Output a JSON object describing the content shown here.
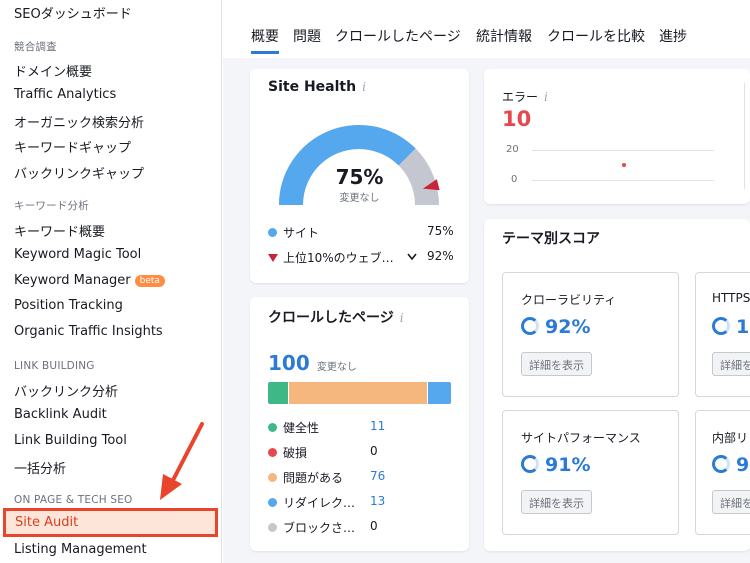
{
  "sidebar": {
    "top_item": "SEOダッシュボード",
    "sections": {
      "competitive": "競合調査",
      "keyword": "キーワード分析",
      "link": "LINK BUILDING",
      "onpage": "ON PAGE & TECH SEO"
    },
    "items": {
      "domain_overview": "ドメイン概要",
      "traffic_analytics": "Traffic Analytics",
      "organic": "オーガニック検索分析",
      "keyword_gap": "キーワードギャップ",
      "backlink_gap": "バックリンクギャップ",
      "keyword_overview": "キーワード概要",
      "keyword_magic": "Keyword Magic Tool",
      "keyword_manager": "Keyword Manager",
      "keyword_manager_badge": "beta",
      "position_tracking": "Position Tracking",
      "organic_insights": "Organic Traffic Insights",
      "backlink_analysis": "バックリンク分析",
      "backlink_audit": "Backlink Audit",
      "link_building": "Link Building Tool",
      "bulk_analysis": "一括分析",
      "site_audit": "Site Audit",
      "listing": "Listing Management"
    }
  },
  "tabs": [
    "概要",
    "問題",
    "クロールしたページ",
    "統計情報",
    "クロールを比較",
    "進捗"
  ],
  "site_health": {
    "title": "Site Health",
    "info": "i",
    "percent_label": "75%",
    "percent": 75,
    "top10_percent": 92,
    "sub": "変更なし",
    "legend": [
      {
        "label": "サイト",
        "value": "75%"
      },
      {
        "label": "上位10%のウェブ…",
        "value": "92%"
      }
    ]
  },
  "errors": {
    "title": "エラー",
    "info": "i",
    "value": "10",
    "axis_20": "20",
    "axis_0": "0"
  },
  "crawled": {
    "title": "クロールしたページ",
    "info": "i",
    "count": "100",
    "sub": "変更なし",
    "bar": [
      {
        "value": 11,
        "color": "#3fb887"
      },
      {
        "value": 76,
        "color": "#f5b77d"
      },
      {
        "value": 13,
        "color": "#55a7ee"
      }
    ],
    "legend": [
      {
        "label": "健全性",
        "value": "11",
        "color": "#3fb887"
      },
      {
        "label": "破損",
        "value": "0",
        "color": "#e5484d"
      },
      {
        "label": "問題がある",
        "value": "76",
        "color": "#f5b77d"
      },
      {
        "label": "リダイレク…",
        "value": "13",
        "color": "#55a7ee"
      },
      {
        "label": "ブロックさ…",
        "value": "0",
        "color": "#c4c7cf"
      }
    ]
  },
  "themes": {
    "title": "テーマ別スコア",
    "cards": [
      {
        "title": "クローラビリティ",
        "score": "92%",
        "button": "詳細を表示"
      },
      {
        "title": "HTTPS",
        "score": "1",
        "button": "詳細を表示"
      },
      {
        "title": "サイトパフォーマンス",
        "score": "91%",
        "button": "詳細を表示"
      },
      {
        "title": "内部リ",
        "score": "9",
        "button": "詳細を表示"
      }
    ]
  }
}
